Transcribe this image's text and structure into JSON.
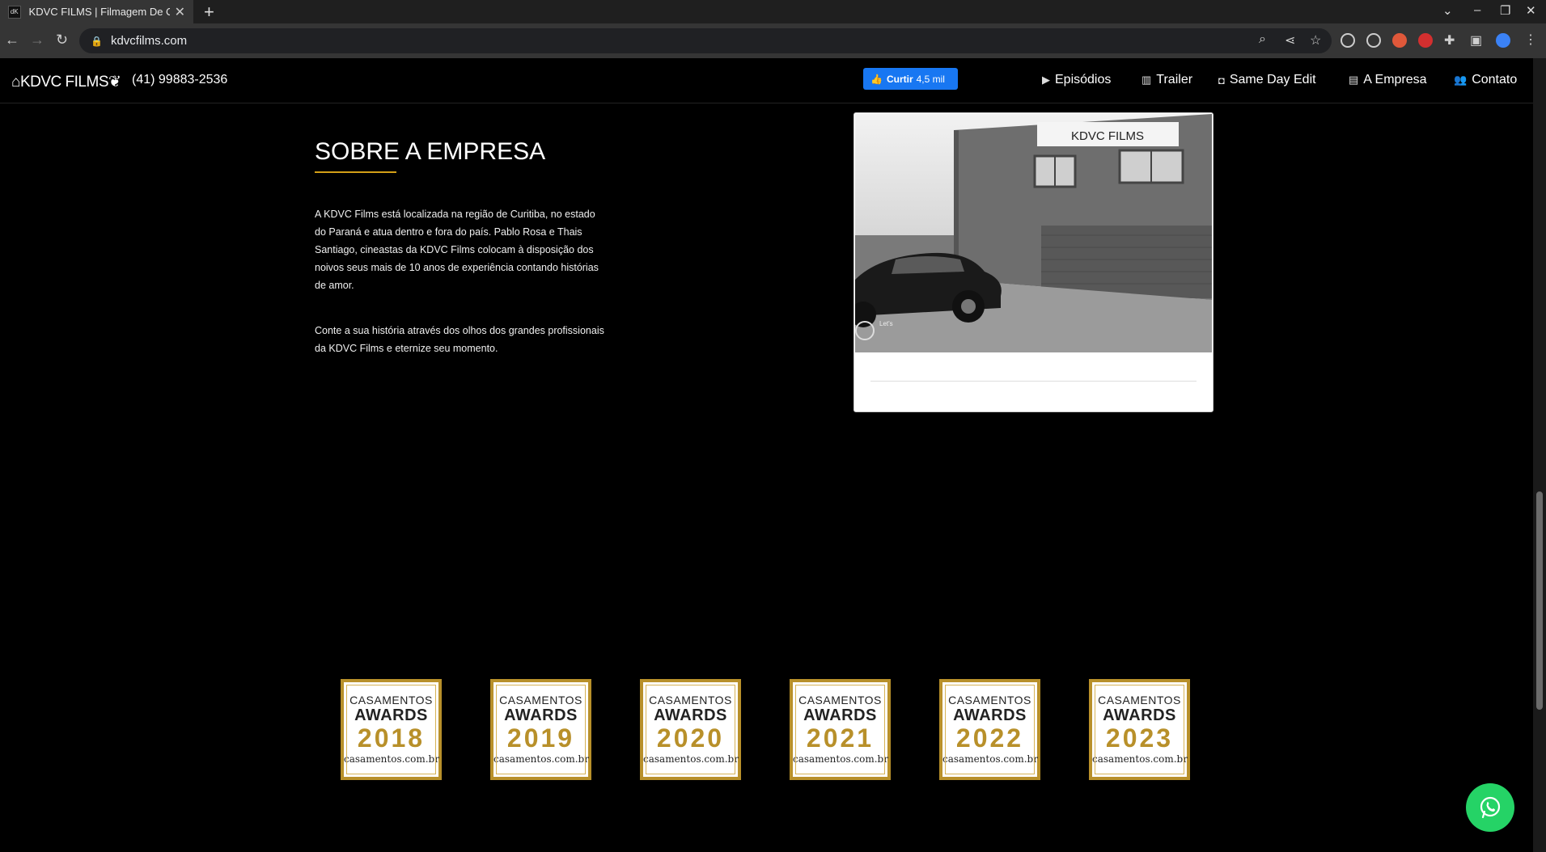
{
  "browser": {
    "tab_title": "KDVC FILMS | Filmagem De Ca",
    "tab_favicon": "kdvc-favicon",
    "url": "kdvcfilms.com"
  },
  "header": {
    "logo_text": "KDVC FILMS",
    "phone": "(41) 99883-2536",
    "like_label": "Curtir",
    "like_count": "4,5 mil",
    "nav": [
      {
        "label": "Episódios",
        "icon": "video-icon"
      },
      {
        "label": "Trailer",
        "icon": "film-icon"
      },
      {
        "label": "Same Day Edit",
        "icon": "camera-icon"
      },
      {
        "label": "A Empresa",
        "icon": "building-icon"
      },
      {
        "label": "Contato",
        "icon": "users-icon"
      }
    ]
  },
  "about": {
    "title": "SOBRE A EMPRESA",
    "paragraph1": "A KDVC Films está localizada na região de Curitiba, no estado do Paraná e atua dentro e fora do país. Pablo Rosa e Thais Santiago, cineastas da KDVC Films colocam à disposição dos noivos seus mais de 10 anos de experiência contando histórias de amor.",
    "paragraph2": "Conte a sua história através dos olhos dos grandes profissionais da KDVC Films e eternize seu momento.",
    "photo_sign": "KDVC FILMS"
  },
  "awards": [
    {
      "line1": "CASAMENTOS",
      "line2": "AWARDS",
      "year": "2018",
      "site": "casamentos.com.br"
    },
    {
      "line1": "CASAMENTOS",
      "line2": "AWARDS",
      "year": "2019",
      "site": "casamentos.com.br"
    },
    {
      "line1": "CASAMENTOS",
      "line2": "AWARDS",
      "year": "2020",
      "site": "casamentos.com.br"
    },
    {
      "line1": "CASAMENTOS",
      "line2": "AWARDS",
      "year": "2021",
      "site": "casamentos.com.br"
    },
    {
      "line1": "CASAMENTOS",
      "line2": "AWARDS",
      "year": "2022",
      "site": "casamentos.com.br"
    },
    {
      "line1": "CASAMENTOS",
      "line2": "AWARDS",
      "year": "2023",
      "site": "casamentos.com.br"
    }
  ],
  "colors": {
    "accent_gold": "#b8902a",
    "facebook_blue": "#1877f2",
    "whatsapp_green": "#25d366"
  }
}
